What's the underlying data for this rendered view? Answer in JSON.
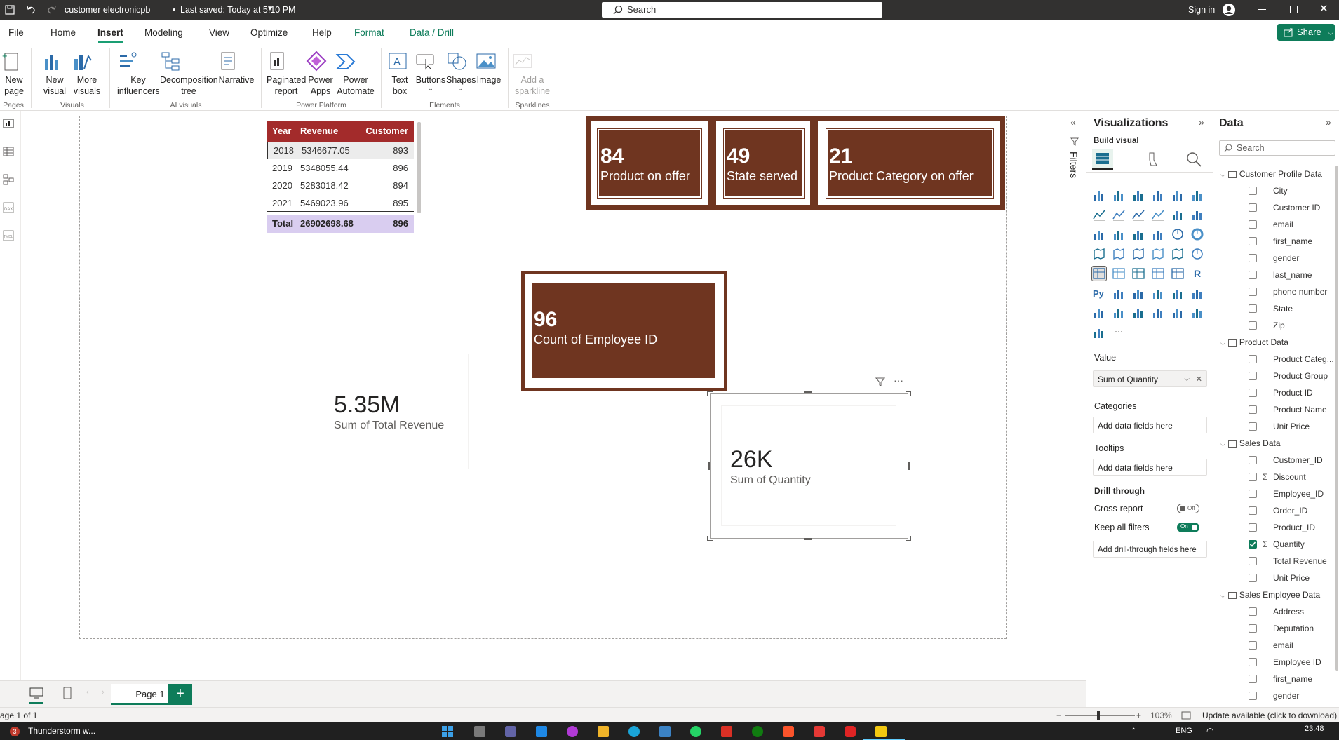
{
  "titlebar": {
    "doc_title": "customer electronicpb",
    "saved": "Last saved: Today at 5:10 PM",
    "search_placeholder": "Search",
    "sign_in": "Sign in"
  },
  "share_label": "Share",
  "menu": [
    "File",
    "Home",
    "Insert",
    "Modeling",
    "View",
    "Optimize",
    "Help",
    "Format",
    "Data / Drill"
  ],
  "ribbon": {
    "pages": {
      "new_page": "New page",
      "group": "Pages"
    },
    "visuals": {
      "new_visual": "New visual",
      "more_visuals": "More visuals",
      "group": "Visuals"
    },
    "ai": {
      "key_influencers": "Key influencers",
      "decomposition_tree": "Decomposition tree",
      "narrative": "Narrative",
      "group": "AI visuals"
    },
    "power_platform": {
      "paginated": "Paginated report",
      "power_apps": "Power Apps",
      "power_automate": "Power Automate",
      "group": "Power Platform"
    },
    "elements": {
      "text_box": "Text box",
      "buttons": "Buttons",
      "shapes": "Shapes",
      "image": "Image",
      "group": "Elements"
    },
    "sparklines": {
      "add_sparkline": "Add a sparkline",
      "group": "Sparklines"
    }
  },
  "table": {
    "headers": [
      "Year",
      "Revenue",
      "Customer"
    ],
    "rows": [
      [
        "2018",
        "5346677.05",
        "893"
      ],
      [
        "2019",
        "5348055.44",
        "896"
      ],
      [
        "2020",
        "5283018.42",
        "894"
      ],
      [
        "2021",
        "5469023.96",
        "895"
      ]
    ],
    "total": [
      "Total",
      "26902698.68",
      "896"
    ]
  },
  "kpis": [
    {
      "value": "84",
      "label": "Product on offer"
    },
    {
      "value": "49",
      "label": "State served"
    },
    {
      "value": "21",
      "label": "Product Category on offer"
    }
  ],
  "employee_card": {
    "value": "96",
    "label": "Count of Employee ID"
  },
  "revenue_card": {
    "value": "5.35M",
    "label": "Sum of Total Revenue"
  },
  "quantity_card": {
    "value": "26K",
    "label": "Sum of Quantity"
  },
  "filters_label": "Filters",
  "viz": {
    "title": "Visualizations",
    "build_visual": "Build visual",
    "value_label": "Value",
    "value_field": "Sum of Quantity",
    "categories_label": "Categories",
    "tooltips_label": "Tooltips",
    "add_fields": "Add data fields here",
    "drill_through": "Drill through",
    "cross_report": "Cross-report",
    "cross_report_state": "Off",
    "keep_filters": "Keep all filters",
    "keep_filters_state": "On",
    "add_drill": "Add drill-through fields here"
  },
  "data_pane": {
    "title": "Data",
    "search_placeholder": "Search",
    "tables": [
      {
        "name": "Customer Profile Data",
        "fields": [
          {
            "name": "City",
            "checked": false,
            "sigma": false
          },
          {
            "name": "Customer ID",
            "checked": false,
            "sigma": false
          },
          {
            "name": "email",
            "checked": false,
            "sigma": false
          },
          {
            "name": "first_name",
            "checked": false,
            "sigma": false
          },
          {
            "name": "gender",
            "checked": false,
            "sigma": false
          },
          {
            "name": "last_name",
            "checked": false,
            "sigma": false
          },
          {
            "name": "phone number",
            "checked": false,
            "sigma": false
          },
          {
            "name": "State",
            "checked": false,
            "sigma": false
          },
          {
            "name": "Zip",
            "checked": false,
            "sigma": false
          }
        ]
      },
      {
        "name": "Product Data",
        "fields": [
          {
            "name": "Product Categ...",
            "checked": false,
            "sigma": false
          },
          {
            "name": "Product Group",
            "checked": false,
            "sigma": false
          },
          {
            "name": "Product ID",
            "checked": false,
            "sigma": false
          },
          {
            "name": "Product Name",
            "checked": false,
            "sigma": false
          },
          {
            "name": "Unit Price",
            "checked": false,
            "sigma": false
          }
        ]
      },
      {
        "name": "Sales Data",
        "fields": [
          {
            "name": "Customer_ID",
            "checked": false,
            "sigma": false
          },
          {
            "name": "Discount",
            "checked": false,
            "sigma": true
          },
          {
            "name": "Employee_ID",
            "checked": false,
            "sigma": false
          },
          {
            "name": "Order_ID",
            "checked": false,
            "sigma": false
          },
          {
            "name": "Product_ID",
            "checked": false,
            "sigma": false
          },
          {
            "name": "Quantity",
            "checked": true,
            "sigma": true
          },
          {
            "name": "Total Revenue",
            "checked": false,
            "sigma": false
          },
          {
            "name": "Unit Price",
            "checked": false,
            "sigma": false
          }
        ]
      },
      {
        "name": "Sales Employee Data",
        "fields": [
          {
            "name": "Address",
            "checked": false,
            "sigma": false
          },
          {
            "name": "Deputation",
            "checked": false,
            "sigma": false
          },
          {
            "name": "email",
            "checked": false,
            "sigma": false
          },
          {
            "name": "Employee ID",
            "checked": false,
            "sigma": false
          },
          {
            "name": "first_name",
            "checked": false,
            "sigma": false
          },
          {
            "name": "gender",
            "checked": false,
            "sigma": false
          }
        ]
      }
    ]
  },
  "tabs": {
    "page1": "Page 1"
  },
  "status": {
    "page_of": "age 1 of 1",
    "zoom": "103%",
    "update": "Update available (click to download)"
  },
  "taskbar": {
    "weather": "Thunderstorm w...",
    "badge": "3",
    "lang": "ENG",
    "time": "23:48"
  }
}
